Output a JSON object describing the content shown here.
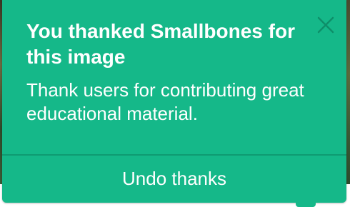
{
  "popup": {
    "title": "You thanked Smallbones for this image",
    "message": "Thank users for contributing great educational material.",
    "undo_label": "Undo thanks",
    "close_icon": "close-icon"
  },
  "colors": {
    "popup_background": "#15b889",
    "divider": "#0f9a72",
    "text": "#ffffff",
    "close_icon": "#0e8f69"
  }
}
